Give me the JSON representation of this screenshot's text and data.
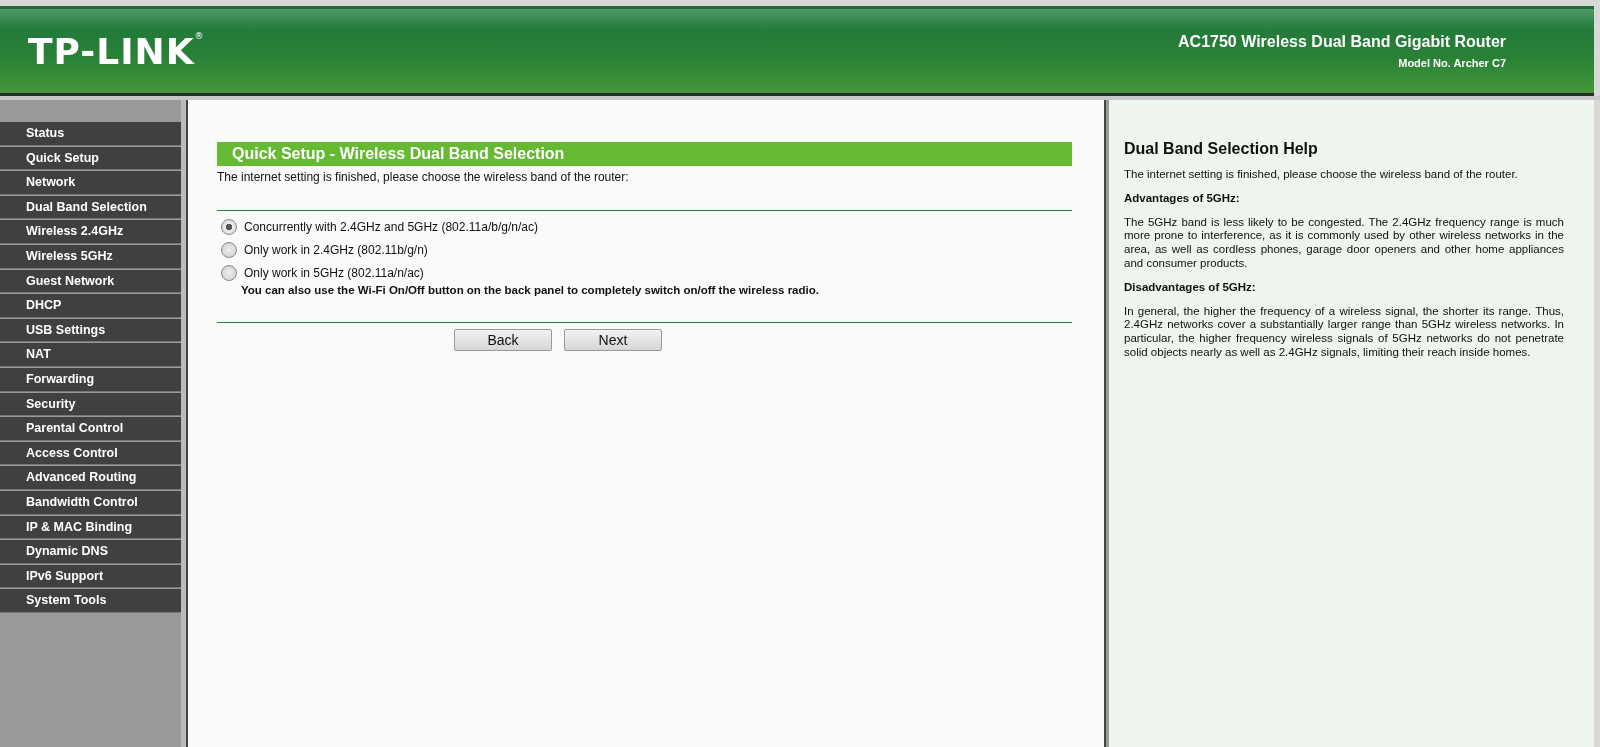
{
  "header": {
    "logo": "TP-LINK$^{®}$",
    "product": "AC1750 Wireless Dual Band Gigabit Router",
    "model": "Model No. Archer C7"
  },
  "sidebar": {
    "items": [
      "Status",
      "Quick Setup",
      "Network",
      "Dual Band Selection",
      "Wireless 2.4GHz",
      "Wireless 5GHz",
      "Guest Network",
      "DHCP",
      "USB Settings",
      "NAT",
      "Forwarding",
      "Security",
      "Parental Control",
      "Access Control",
      "Advanced Routing",
      "Bandwidth Control",
      "IP & MAC Binding",
      "Dynamic DNS",
      "IPv6 Support",
      "System Tools"
    ]
  },
  "main": {
    "title": "Quick Setup - Wireless Dual Band Selection",
    "intro": "The internet setting is finished, please choose the wireless band of the router:",
    "options": [
      {
        "label": "Concurrently with 2.4GHz and 5GHz (802.11a/b/g/n/ac)",
        "selected": true
      },
      {
        "label": "Only work in 2.4GHz (802.11b/g/n)",
        "selected": false
      },
      {
        "label": "Only work in 5GHz (802.11a/n/ac)",
        "selected": false
      }
    ],
    "note": "You can also use the Wi-Fi On/Off button on the back panel to completely switch on/off the wireless radio.",
    "buttons": [
      "Back",
      "Next"
    ]
  },
  "help": {
    "title": "Dual Band Selection Help",
    "paragraphs": [
      {
        "kind": "text",
        "text": "The internet setting is finished, please choose the wireless band of the router."
      },
      {
        "kind": "heading",
        "text": "Advantages of 5GHz:"
      },
      {
        "kind": "text",
        "text": "The 5GHz band is less likely to be congested. The 2.4GHz frequency range is much more prone to interference, as it is commonly used by other wireless networks in the area, as well as cordless phones, garage door openers and other home appliances and consumer products."
      },
      {
        "kind": "heading",
        "text": "Disadvantages of 5GHz:"
      },
      {
        "kind": "text",
        "text": "In general, the higher the frequency of a wireless signal, the shorter its range. Thus, 2.4GHz networks cover a substantially larger range than 5GHz wireless networks. In particular, the higher frequency wireless signals of 5GHz networks do not penetrate solid objects nearly as well as 2.4GHz signals, limiting their reach inside homes."
      }
    ]
  }
}
